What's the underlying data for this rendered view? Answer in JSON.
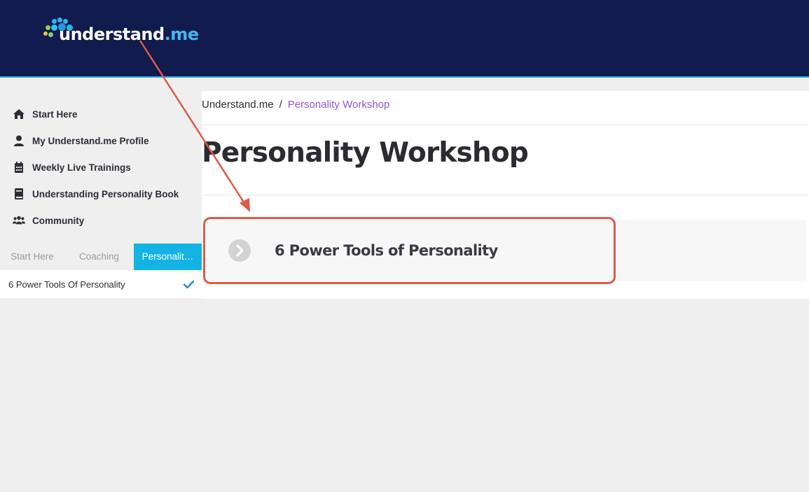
{
  "header": {
    "logo_text_main": "understand",
    "logo_text_dot": ".me"
  },
  "sidebar": {
    "items": [
      {
        "icon": "home-icon",
        "label": "Start Here"
      },
      {
        "icon": "user-icon",
        "label": "My Understand.me Profile"
      },
      {
        "icon": "calendar-icon",
        "label": "Weekly Live Trainings"
      },
      {
        "icon": "book-icon",
        "label": "Understanding Personality Book"
      },
      {
        "icon": "users-icon",
        "label": "Community"
      }
    ],
    "tabs": [
      {
        "label": "Start Here",
        "active": false
      },
      {
        "label": "Coaching",
        "active": false
      },
      {
        "label": "Personalit…",
        "active": true
      }
    ],
    "lessons": [
      {
        "label": "6 Power Tools Of Personality",
        "completed": true
      }
    ]
  },
  "main": {
    "breadcrumb": {
      "home": "Understand.me",
      "separator": "/",
      "current": "Personality Workshop"
    },
    "title": "Personality Workshop",
    "lessons": [
      {
        "title": "6 Power Tools of Personality"
      }
    ]
  },
  "colors": {
    "header_bg": "#111b4d",
    "accent_tab": "#14b3e6",
    "breadcrumb_current": "#9254de",
    "check": "#1e88e5",
    "annotation": "#e05a47"
  }
}
